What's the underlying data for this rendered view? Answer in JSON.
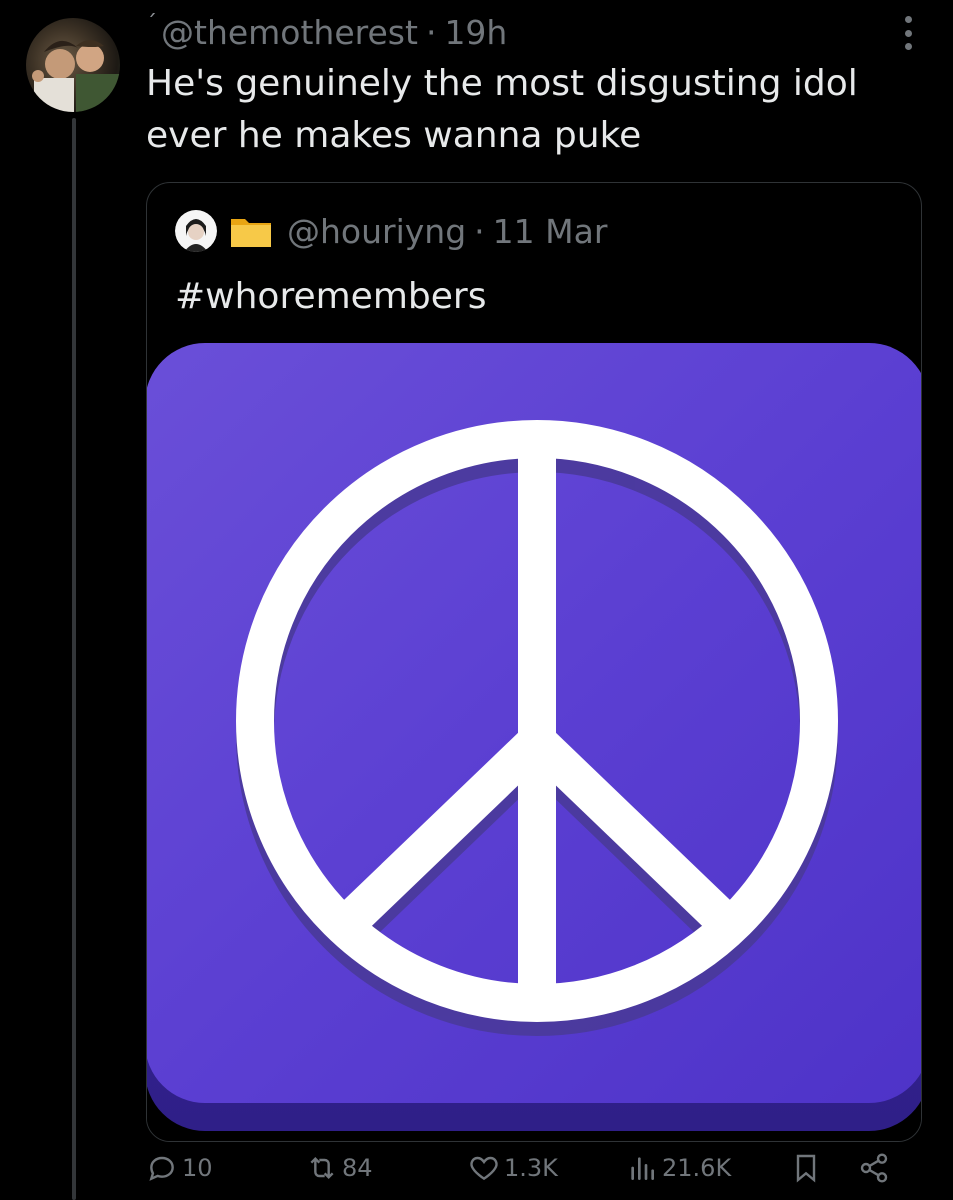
{
  "tweet": {
    "handle": "@themotherest",
    "separator": "·",
    "time": "19h",
    "text": "He's genuinely the most disgusting idol ever he makes wanna puke"
  },
  "quote": {
    "handle": "@houriyng",
    "separator": "·",
    "date": "11 Mar",
    "text": "#whoremembers",
    "media_icon": "peace-sign",
    "media_color": "#6a4fd6"
  },
  "actions": {
    "replies": "10",
    "reposts": "84",
    "likes": "1.3K",
    "views": "21.6K"
  },
  "icons": {
    "more": "more-vertical-icon",
    "reply": "reply-icon",
    "repost": "repost-icon",
    "like": "heart-icon",
    "views": "views-icon",
    "bookmark": "bookmark-icon",
    "share": "share-icon",
    "folder": "folder-icon"
  },
  "colors": {
    "background": "#000000",
    "text_primary": "#e7e9ea",
    "text_secondary": "#71767b",
    "border": "#2f3336",
    "media_purple": "#6a4fd6"
  }
}
